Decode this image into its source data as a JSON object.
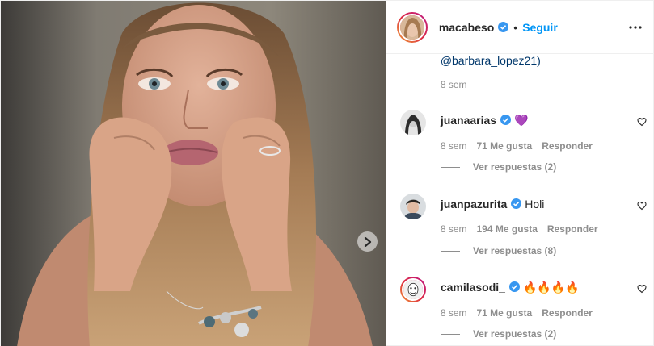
{
  "header": {
    "username": "macabeso",
    "dot": "•",
    "follow_label": "Seguir"
  },
  "caption_tail": {
    "mention": "@barbara_lopez21)",
    "time": "8 sem"
  },
  "comments": [
    {
      "user": "juanaarias",
      "verified": true,
      "text": "💜",
      "time": "8 sem",
      "likes": "71 Me gusta",
      "reply_label": "Responder",
      "view_replies": "Ver respuestas (2)"
    },
    {
      "user": "juanpazurita",
      "verified": true,
      "text": "Holi",
      "time": "8 sem",
      "likes": "194 Me gusta",
      "reply_label": "Responder",
      "view_replies": "Ver respuestas (8)"
    },
    {
      "user": "camilasodi_",
      "verified": true,
      "text": "🔥🔥🔥🔥",
      "time": "8 sem",
      "likes": "71 Me gusta",
      "reply_label": "Responder",
      "view_replies": "Ver respuestas (2)"
    }
  ],
  "colors": {
    "accent": "#0095f6",
    "verified": "#3897f0",
    "secondary_text": "#8e8e8e"
  },
  "icons": {
    "next": "chevron-right-icon",
    "more": "more-horizontal-icon",
    "like": "heart-outline-icon",
    "verified": "verified-badge-icon"
  }
}
